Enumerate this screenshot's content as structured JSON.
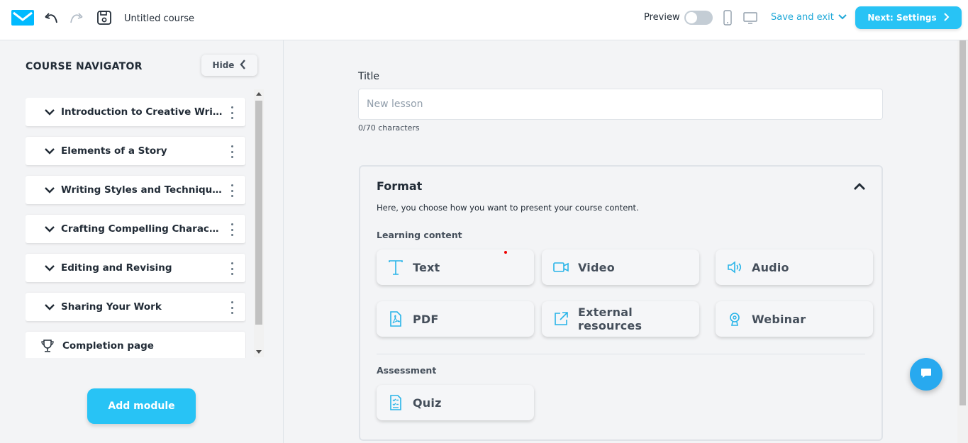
{
  "header": {
    "course_title": "Untitled course",
    "preview_label": "Preview",
    "save_exit_label": "Save and exit",
    "next_label": "Next: Settings",
    "accent_color": "#28c3f5"
  },
  "sidebar": {
    "title": "COURSE NAVIGATOR",
    "hide_label": "Hide",
    "modules": [
      {
        "label": "Introduction to Creative Writ..."
      },
      {
        "label": "Elements of a Story"
      },
      {
        "label": "Writing Styles and Techniques"
      },
      {
        "label": "Crafting Compelling Charact..."
      },
      {
        "label": "Editing and Revising"
      },
      {
        "label": "Sharing Your Work"
      }
    ],
    "completion_label": "Completion page",
    "add_module_label": "Add module"
  },
  "main": {
    "title_label": "Title",
    "title_placeholder": "New lesson",
    "title_value": "",
    "char_count": "0/70 characters",
    "format": {
      "title": "Format",
      "description": "Here, you choose how you want to present your course content.",
      "learning_label": "Learning content",
      "learning_items": [
        {
          "label": "Text",
          "icon": "text-icon"
        },
        {
          "label": "Video",
          "icon": "video-icon"
        },
        {
          "label": "Audio",
          "icon": "audio-icon"
        },
        {
          "label": "PDF",
          "icon": "pdf-icon"
        },
        {
          "label": "External resources",
          "icon": "external-link-icon"
        },
        {
          "label": "Webinar",
          "icon": "webinar-icon"
        }
      ],
      "assessment_label": "Assessment",
      "assessment_items": [
        {
          "label": "Quiz",
          "icon": "quiz-icon"
        }
      ]
    }
  }
}
